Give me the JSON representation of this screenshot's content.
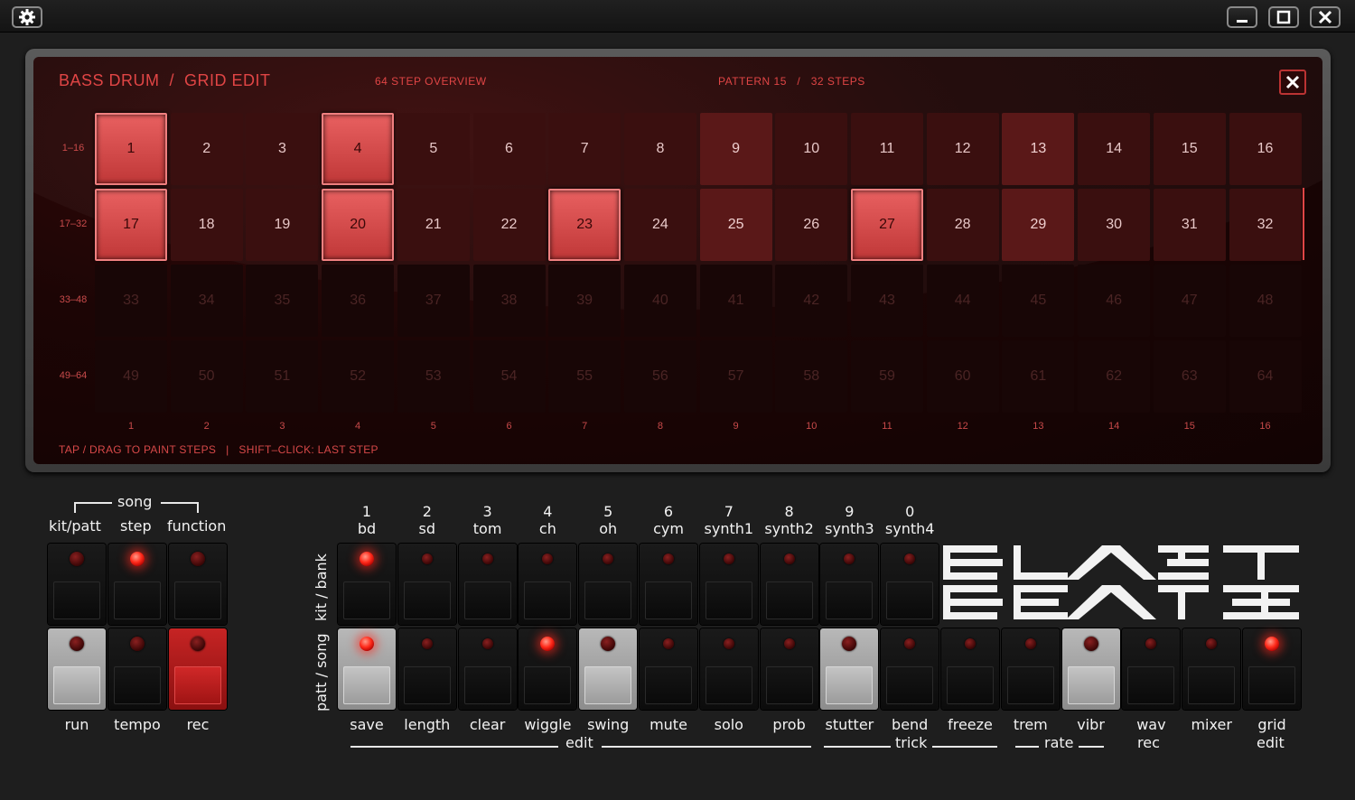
{
  "window": {
    "settings_icon": "gear-icon",
    "controls": [
      "minimize-icon",
      "maximize-icon",
      "close-icon"
    ]
  },
  "grid_editor": {
    "title": "BASS DRUM  /  GRID EDIT",
    "overview": "64 STEP OVERVIEW",
    "pattern_info": "PATTERN 15   /   32 STEPS",
    "row_labels": [
      "1–16",
      "17–32",
      "33–48",
      "49–64"
    ],
    "column_labels": [
      "1",
      "2",
      "3",
      "4",
      "5",
      "6",
      "7",
      "8",
      "9",
      "10",
      "11",
      "12",
      "13",
      "14",
      "15",
      "16"
    ],
    "active_steps": [
      1,
      4,
      17,
      20,
      23,
      27
    ],
    "accent_steps": [
      9,
      13,
      25,
      29
    ],
    "pattern_length": 32,
    "hint": "TAP / DRAG TO PAINT STEPS   |   SHIFT–CLICK: LAST STEP"
  },
  "transport": {
    "song_label": "song",
    "top_labels": [
      "kit/patt",
      "step",
      "function"
    ],
    "top_led_lit": [
      false,
      true,
      false
    ],
    "bottom_buttons": [
      {
        "label": "run",
        "state": "grey",
        "led_lit": false
      },
      {
        "label": "tempo",
        "state": "normal",
        "led_lit": false
      },
      {
        "label": "rec",
        "state": "red",
        "led_lit": false
      }
    ]
  },
  "instruments": {
    "side_labels": [
      "kit / bank",
      "patt / song"
    ],
    "tracks": [
      {
        "num": "1",
        "name": "bd",
        "led_lit": true
      },
      {
        "num": "2",
        "name": "sd",
        "led_lit": false
      },
      {
        "num": "3",
        "name": "tom",
        "led_lit": false
      },
      {
        "num": "4",
        "name": "ch",
        "led_lit": false
      },
      {
        "num": "5",
        "name": "oh",
        "led_lit": false
      },
      {
        "num": "6",
        "name": "cym",
        "led_lit": false
      },
      {
        "num": "7",
        "name": "synth1",
        "led_lit": false
      },
      {
        "num": "8",
        "name": "synth2",
        "led_lit": false
      },
      {
        "num": "9",
        "name": "synth3",
        "led_lit": false
      },
      {
        "num": "0",
        "name": "synth4",
        "led_lit": false
      }
    ],
    "function_buttons": [
      {
        "label": "save",
        "state": "grey",
        "led_lit": true
      },
      {
        "label": "length",
        "state": "normal",
        "led_lit": false
      },
      {
        "label": "clear",
        "state": "normal",
        "led_lit": false
      },
      {
        "label": "wiggle",
        "state": "normal",
        "led_lit": true
      },
      {
        "label": "swing",
        "state": "grey",
        "led_lit": false
      },
      {
        "label": "mute",
        "state": "normal",
        "led_lit": false
      },
      {
        "label": "solo",
        "state": "normal",
        "led_lit": false
      },
      {
        "label": "prob",
        "state": "normal",
        "led_lit": false
      },
      {
        "label": "stutter",
        "state": "grey",
        "led_lit": false
      },
      {
        "label": "bend",
        "state": "normal",
        "led_lit": false
      },
      {
        "label": "freeze",
        "state": "normal",
        "led_lit": false
      },
      {
        "label": "trem",
        "state": "normal",
        "led_lit": false
      },
      {
        "label": "vibr",
        "state": "grey",
        "led_lit": false
      },
      {
        "label": "wav",
        "state": "normal",
        "led_lit": false
      },
      {
        "label": "mixer",
        "state": "normal",
        "led_lit": false
      },
      {
        "label": "grid",
        "state": "normal",
        "led_lit": true
      }
    ],
    "group_labels": {
      "edit": "edit",
      "trick": "trick",
      "rate": "rate",
      "wav_sub": "rec",
      "grid_sub": "edit"
    }
  },
  "logo": {
    "text": "BLAST BEATS"
  },
  "colors": {
    "accent": "#e04545",
    "led_on": "#ff2a1a",
    "rec_red": "#c62424"
  }
}
